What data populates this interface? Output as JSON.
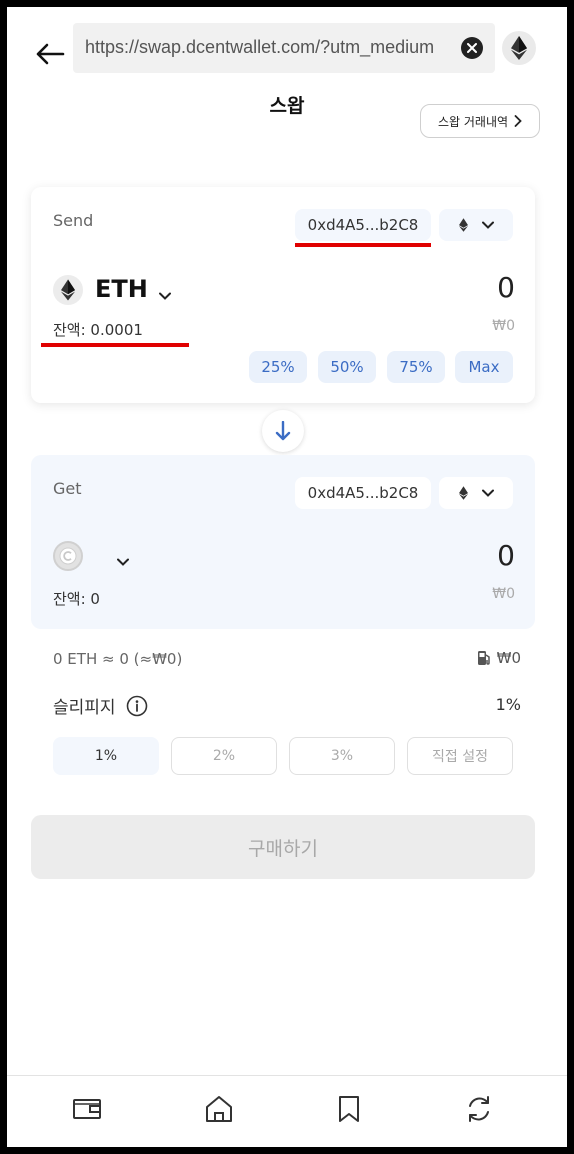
{
  "browser": {
    "url": "https://swap.dcentwallet.com/?utm_medium",
    "back_icon": "arrow-left-icon",
    "clear_icon": "close-icon",
    "favicon": "eth-icon"
  },
  "header": {
    "title": "스왑",
    "history_label": "스왑 거래내역"
  },
  "send": {
    "label": "Send",
    "address": "0xd4A5...b2C8",
    "token": "ETH",
    "amount": "0",
    "balance": "잔액: 0.0001",
    "fiat": "₩0",
    "percent_buttons": [
      "25%",
      "50%",
      "75%",
      "Max"
    ]
  },
  "get": {
    "label": "Get",
    "address": "0xd4A5...b2C8",
    "amount": "0",
    "balance": "잔액: 0",
    "fiat": "₩0"
  },
  "rate": {
    "text": "0 ETH ≈ 0 (≈₩0)",
    "gas_fee": "₩0"
  },
  "slippage": {
    "label": "슬리피지",
    "value": "1%",
    "options": [
      "1%",
      "2%",
      "3%",
      "직접 설정"
    ],
    "selected": "1%"
  },
  "buy_button": "구매하기",
  "bottom_nav": [
    "wallet-icon",
    "home-icon",
    "bookmark-icon",
    "swap-icon"
  ],
  "colors": {
    "accent": "#3b6cc4",
    "highlight": "#e00000",
    "card_tint": "#f3f7fd"
  }
}
